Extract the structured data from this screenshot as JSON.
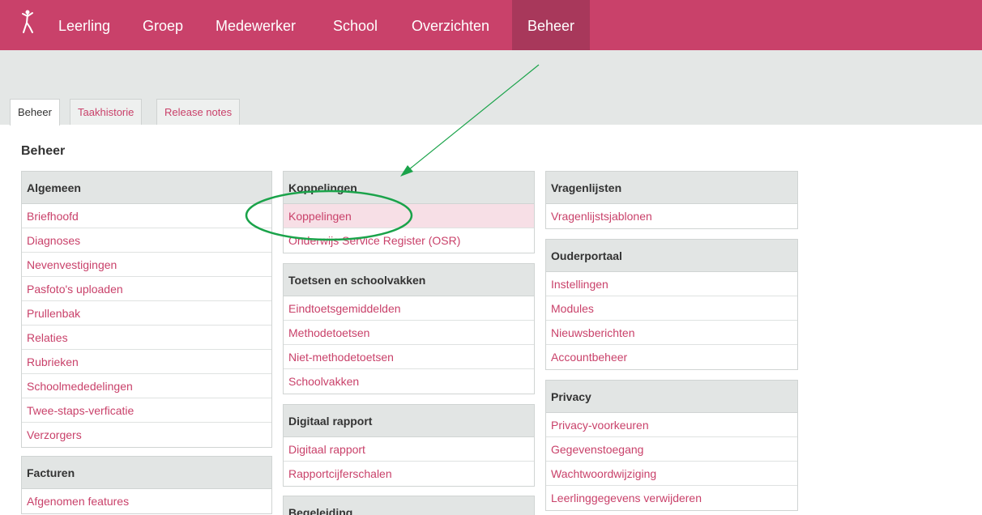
{
  "nav": {
    "items": [
      "Leerling",
      "Groep",
      "Medewerker",
      "School",
      "Overzichten",
      "Beheer"
    ],
    "active": "Beheer"
  },
  "tabs": [
    "Beheer",
    "Taakhistorie",
    "Release notes"
  ],
  "page_title": "Beheer",
  "sections": {
    "algemeen": {
      "title": "Algemeen",
      "items": [
        "Briefhoofd",
        "Diagnoses",
        "Nevenvestigingen",
        "Pasfoto's uploaden",
        "Prullenbak",
        "Relaties",
        "Rubrieken",
        "Schoolmededelingen",
        "Twee-staps-verficatie",
        "Verzorgers"
      ]
    },
    "facturen": {
      "title": "Facturen",
      "items": [
        "Afgenomen features"
      ]
    },
    "koppelingen": {
      "title": "Koppelingen",
      "items": [
        "Koppelingen",
        "Onderwijs Service Register (OSR)"
      ]
    },
    "toetsen": {
      "title": "Toetsen en schoolvakken",
      "items": [
        "Eindtoetsgemiddelden",
        "Methodetoetsen",
        "Niet-methodetoetsen",
        "Schoolvakken"
      ]
    },
    "digitaal": {
      "title": "Digitaal rapport",
      "items": [
        "Digitaal rapport",
        "Rapportcijferschalen"
      ]
    },
    "begeleiding": {
      "title": "Begeleiding",
      "items": []
    },
    "vragenlijsten": {
      "title": "Vragenlijsten",
      "items": [
        "Vragenlijstsjablonen"
      ]
    },
    "ouderportaal": {
      "title": "Ouderportaal",
      "items": [
        "Instellingen",
        "Modules",
        "Nieuwsberichten",
        "Accountbeheer"
      ]
    },
    "privacy": {
      "title": "Privacy",
      "items": [
        "Privacy-voorkeuren",
        "Gegevenstoegang",
        "Wachtwoordwijziging",
        "Leerlinggegevens verwijderen"
      ]
    }
  },
  "colors": {
    "brand": "#c9416a",
    "brand_active": "#a8385b",
    "annotation": "#1aa34a"
  },
  "icons": {
    "logo": "dancer-logo-icon",
    "annotation_arrow": "arrow-annotation-icon",
    "annotation_circle": "circle-annotation"
  }
}
